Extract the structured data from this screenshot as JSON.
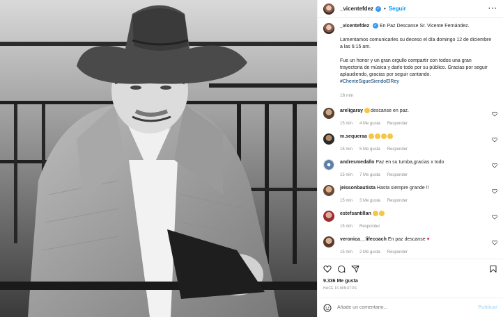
{
  "header": {
    "username": "_vicentefdez",
    "verified_glyph": "✓",
    "separator": "•",
    "follow_label": "Seguir",
    "more_label": "···"
  },
  "caption": {
    "username": "_vicentefdez",
    "verified_glyph": "✓",
    "line1": "En Paz Descanse Sr. Vicente Fernández.",
    "para1": "Lamentamos comunicarles su deceso el día domingo 12 de diciembre a las 6:15 am.",
    "para2": "Fue un honor y un gran orgullo compartir con todos una gran trayectoria de música y darlo todo por su público. Gracias por seguir aplaudiendo, gracias por seguir cantando.",
    "hashtag": "#ChenteSigueSiendoElRey",
    "time": "16 min"
  },
  "comments": [
    {
      "user": "areligaray",
      "text": "descanse en paz.",
      "time": "15 min",
      "likes": "4 Me gusta",
      "reply": "Responder",
      "emoji_count": 1
    },
    {
      "user": "m.sequeraa",
      "text": "",
      "time": "15 min",
      "likes": "5 Me gusta",
      "reply": "Responder",
      "emoji_count": 4
    },
    {
      "user": "andresmedallo",
      "text": "Paz en su tumba,gracias x todo",
      "time": "15 min",
      "likes": "7 Me gusta",
      "reply": "Responder",
      "emoji_count": 0
    },
    {
      "user": "jeissonbautista",
      "text": "Hasta siempre grande !!",
      "time": "15 min",
      "likes": "3 Me gusta",
      "reply": "Responder",
      "emoji_count": 0
    },
    {
      "user": "estefsantillan",
      "text": "",
      "time": "15 min",
      "likes": "",
      "reply": "Responder",
      "emoji_count": 2
    },
    {
      "user": "veronica__lifecoach",
      "text": "En paz descanse",
      "time": "15 min",
      "likes": "2 Me gusta",
      "reply": "Responder",
      "emoji_count": 0,
      "heart": "♥"
    }
  ],
  "footer": {
    "likes": "9.336 Me gusta",
    "ago": "HACE 16 MINUTOS",
    "comment_placeholder": "Añade un comentario...",
    "publish_label": "Publicar"
  },
  "colors": {
    "link_blue": "#0095f6",
    "verified_blue": "#3897f0",
    "heart_red": "#e0245e",
    "muted": "#8e8e8e"
  },
  "icons": [
    "heart-icon",
    "comment-icon",
    "share-icon",
    "bookmark-icon",
    "emoji-icon",
    "more-icon"
  ]
}
